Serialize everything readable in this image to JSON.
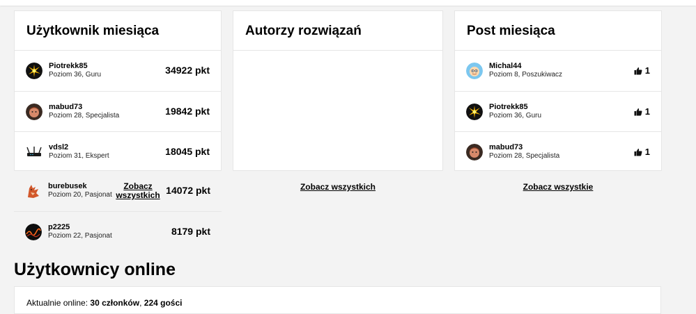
{
  "user_of_month": {
    "title": "Użytkownik miesiąca",
    "see_all": "Zobacz wszystkich",
    "users": [
      {
        "name": "Piotrekk85",
        "level": "Poziom 36, Guru",
        "points": "34922 pkt",
        "avatar": "fireworks-avatar-icon"
      },
      {
        "name": "mabud73",
        "level": "Poziom 28, Specjalista",
        "points": "19842 pkt",
        "avatar": "face-avatar-icon"
      },
      {
        "name": "vdsl2",
        "level": "Poziom 31, Ekspert",
        "points": "18045 pkt",
        "avatar": "router-avatar-icon"
      },
      {
        "name": "burebusek",
        "level": "Poziom 20, Pasjonat",
        "points": "14072 pkt",
        "avatar": "fox-avatar-icon"
      },
      {
        "name": "p2225",
        "level": "Poziom 22, Pasjonat",
        "points": "8179 pkt",
        "avatar": "abstract-avatar-icon"
      }
    ]
  },
  "solution_authors": {
    "title": "Autorzy rozwiązań",
    "see_all": "Zobacz wszystkich"
  },
  "post_of_month": {
    "title": "Post miesiąca",
    "see_all": "Zobacz wszystkie",
    "posts": [
      {
        "name": "Michal44",
        "level": "Poziom 8, Poszukiwacz",
        "likes": "1",
        "avatar": "cartoon-avatar-icon"
      },
      {
        "name": "Piotrekk85",
        "level": "Poziom 36, Guru",
        "likes": "1",
        "avatar": "fireworks-avatar-icon"
      },
      {
        "name": "mabud73",
        "level": "Poziom 28, Specjalista",
        "likes": "1",
        "avatar": "face-avatar-icon"
      }
    ]
  },
  "online": {
    "title": "Użytkownicy online",
    "prefix": "Aktualnie online: ",
    "members": "30 członków",
    "separator": ", ",
    "guests": "224 gości"
  },
  "colors": {
    "background": "#f3f3f3",
    "card": "#ffffff",
    "border": "#e6e6e6"
  }
}
